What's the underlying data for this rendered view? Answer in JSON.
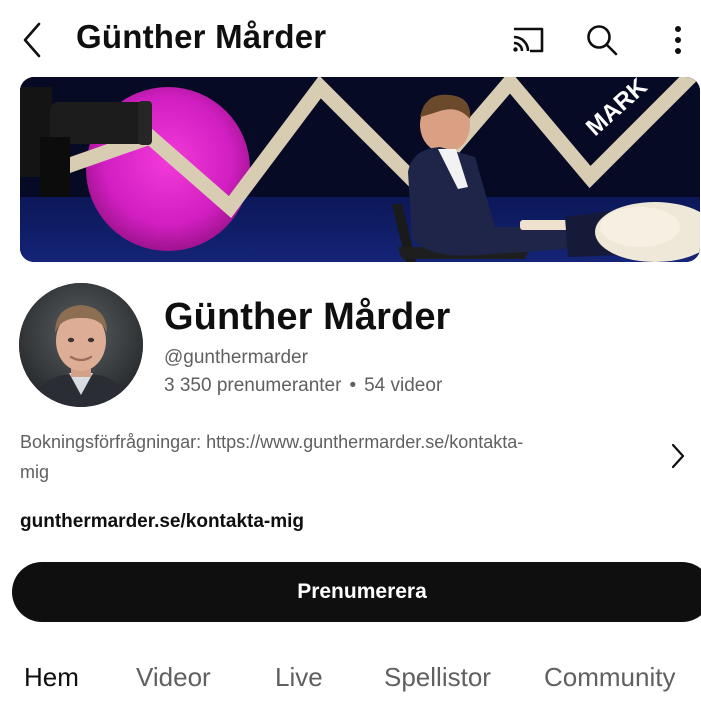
{
  "header": {
    "title": "Günther Mårder",
    "icons": [
      "back-arrow-icon",
      "cast-icon",
      "search-icon",
      "more-vertical-icon"
    ]
  },
  "banner": {
    "stage_sign": "MARK"
  },
  "channel": {
    "name": "Günther Mårder",
    "handle": "@gunthermarder",
    "subscribers": "3 350 prenumeranter",
    "separator": "•",
    "videos": "54 videor"
  },
  "description": {
    "line1": "Bokningsförfrågningar: https://www.gunthermarder.se/kontakta-",
    "line2": "mig"
  },
  "link": "gunthermarder.se/kontakta-mig",
  "subscribe_label": "Prenumerera",
  "tabs": [
    {
      "label": "Hem",
      "active": true
    },
    {
      "label": "Videor",
      "active": false
    },
    {
      "label": "Live",
      "active": false
    },
    {
      "label": "Spellistor",
      "active": false
    },
    {
      "label": "Community",
      "active": false
    }
  ],
  "colors": {
    "primary_text": "#0f0f0f",
    "secondary_text": "#606060",
    "button_bg": "#0f0f0f"
  }
}
